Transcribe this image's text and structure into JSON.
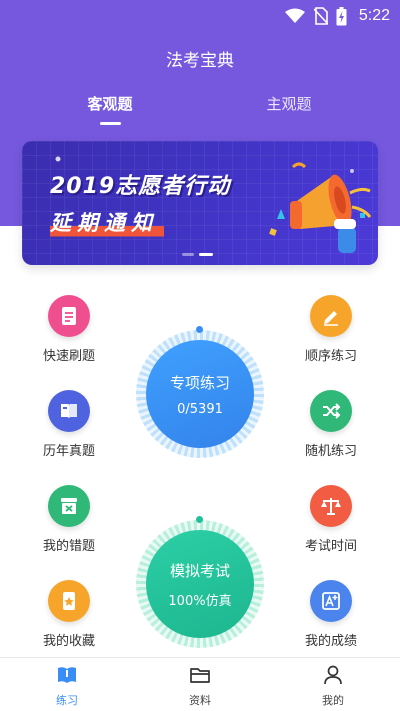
{
  "status_bar": {
    "time": "5:22"
  },
  "header": {
    "title": "法考宝典",
    "tabs": [
      {
        "label": "客观题",
        "active": true
      },
      {
        "label": "主观题",
        "active": false
      }
    ]
  },
  "banner": {
    "line1": "2019志愿者行动",
    "line2": "延期通知",
    "slides": 2,
    "active_slide": 2
  },
  "features_left": [
    {
      "label": "快速刷题",
      "icon": "document-icon",
      "color": "#EF4F8F"
    },
    {
      "label": "历年真题",
      "icon": "book-icon",
      "color": "#4F63E0"
    },
    {
      "label": "我的错题",
      "icon": "error-box-icon",
      "color": "#2FB877"
    },
    {
      "label": "我的收藏",
      "icon": "star-bookmark-icon",
      "color": "#F6A52A"
    }
  ],
  "features_right": [
    {
      "label": "顺序练习",
      "icon": "pencil-icon",
      "color": "#F6A52A"
    },
    {
      "label": "随机练习",
      "icon": "shuffle-icon",
      "color": "#2FB877"
    },
    {
      "label": "考试时间",
      "icon": "scale-icon",
      "color": "#F25C43"
    },
    {
      "label": "我的成绩",
      "icon": "grade-a-plus-icon",
      "color": "#4B84EC"
    }
  ],
  "special_practice": {
    "title": "专项练习",
    "progress_text": "0/5391",
    "done": 0,
    "total": 5391
  },
  "mock_exam": {
    "title": "模拟考试",
    "subtitle": "100%仿真"
  },
  "bottom_nav": [
    {
      "label": "练习",
      "icon": "practice-book-icon",
      "active": true
    },
    {
      "label": "资料",
      "icon": "folder-icon",
      "active": false
    },
    {
      "label": "我的",
      "icon": "person-icon",
      "active": false
    }
  ],
  "colors": {
    "header": "#7558DE",
    "blue_circle": "#3A8DF5",
    "green_circle": "#22C09A",
    "active_nav": "#3A8DF5"
  }
}
